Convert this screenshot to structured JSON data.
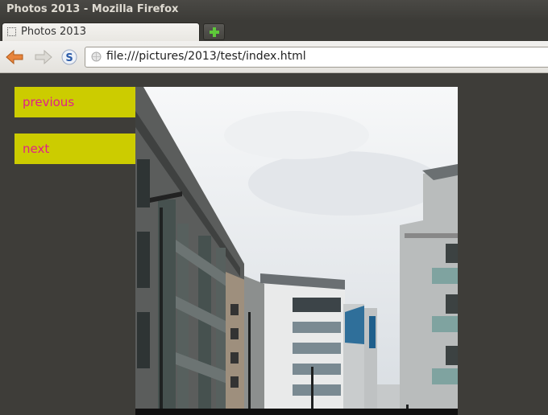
{
  "window": {
    "title": "Photos 2013 - Mozilla Firefox"
  },
  "tabs": [
    {
      "label": "Photos 2013"
    }
  ],
  "navbar": {
    "url": "file:///pictures/2013/test/index.html"
  },
  "page": {
    "previous_label": "previous",
    "next_label": "next"
  },
  "colors": {
    "link_bg": "#cccc00",
    "link_text": "#e0208a",
    "page_bg": "#3e3d39"
  }
}
